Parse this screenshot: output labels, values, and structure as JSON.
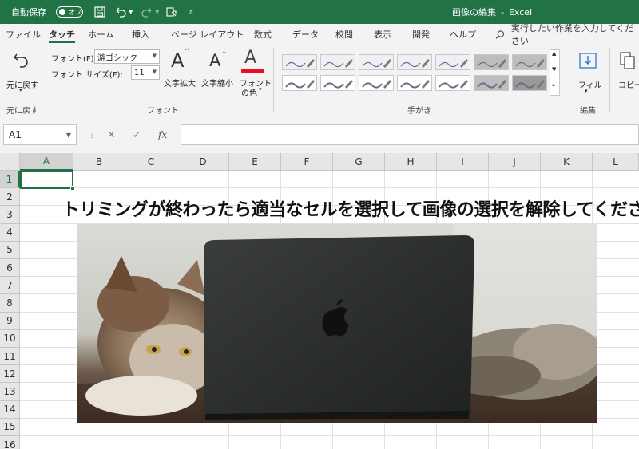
{
  "titlebar": {
    "autosave_label": "自動保存",
    "autosave_state": "オフ",
    "title": "画像の編集",
    "separator": "-",
    "app": "Excel",
    "bg_color": "#217346"
  },
  "tabs": [
    {
      "label": "ファイル"
    },
    {
      "label": "タッチ"
    },
    {
      "label": "ホーム"
    },
    {
      "label": "挿入"
    },
    {
      "label": "ページ レイアウト"
    },
    {
      "label": "数式"
    },
    {
      "label": "データ"
    },
    {
      "label": "校閲"
    },
    {
      "label": "表示"
    },
    {
      "label": "開発"
    },
    {
      "label": "ヘルプ"
    }
  ],
  "active_tab": "タッチ",
  "search": {
    "placeholder": "実行したい作業を入力してください"
  },
  "ribbon": {
    "undo_group": {
      "button_label": "元に戻す",
      "group_label": "元に戻す"
    },
    "font_group": {
      "font_label": "フォント(F):",
      "font_value": "游ゴシック",
      "size_label": "フォント サイズ(F):",
      "size_value": "11",
      "grow_label": "文字拡大",
      "shrink_label": "文字縮小",
      "color_label_1": "フォント",
      "color_label_2": "の色",
      "font_color": "#e81123",
      "group_label": "フォント"
    },
    "ink_group": {
      "group_label": "手がき"
    },
    "edit_group": {
      "fill_label": "フィル",
      "group_label": "編集",
      "copy_label": "コピー"
    }
  },
  "formulabar": {
    "name_box": "A1",
    "cancel_icon": "✕",
    "enter_icon": "✓",
    "fx_label": "fx",
    "value": ""
  },
  "grid": {
    "columns": [
      "A",
      "B",
      "C",
      "D",
      "E",
      "F",
      "G",
      "H",
      "I",
      "J",
      "K",
      "L"
    ],
    "rows": [
      "1",
      "2",
      "3",
      "4",
      "5",
      "6",
      "7",
      "8",
      "9",
      "10",
      "11",
      "12",
      "13",
      "14",
      "15",
      "16"
    ],
    "selected_column": "A",
    "selected_row": "1",
    "sheet_text": "トリミングが終わったら適当なセルを選択して画像の選択を解除してください"
  },
  "photo": {
    "subject": "cat-with-laptop-photo"
  }
}
